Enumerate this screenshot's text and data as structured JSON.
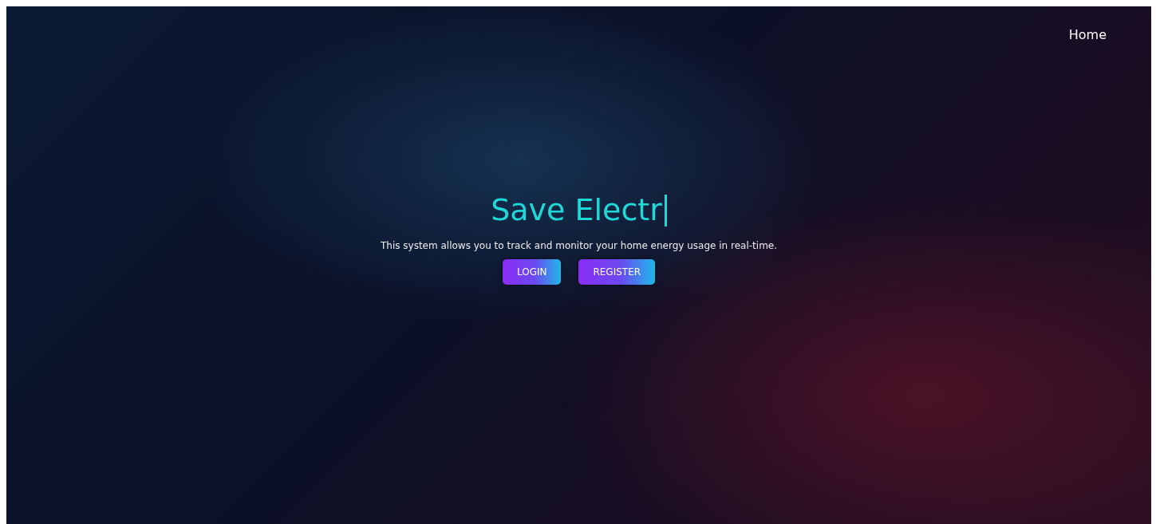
{
  "nav": {
    "items": [
      {
        "label": "Home"
      }
    ]
  },
  "hero": {
    "title": "Save Electr",
    "description": "This system allows you to track and monitor your home energy usage in real-time.",
    "buttons": [
      {
        "label": "LOGIN"
      },
      {
        "label": "REGISTER"
      }
    ]
  }
}
